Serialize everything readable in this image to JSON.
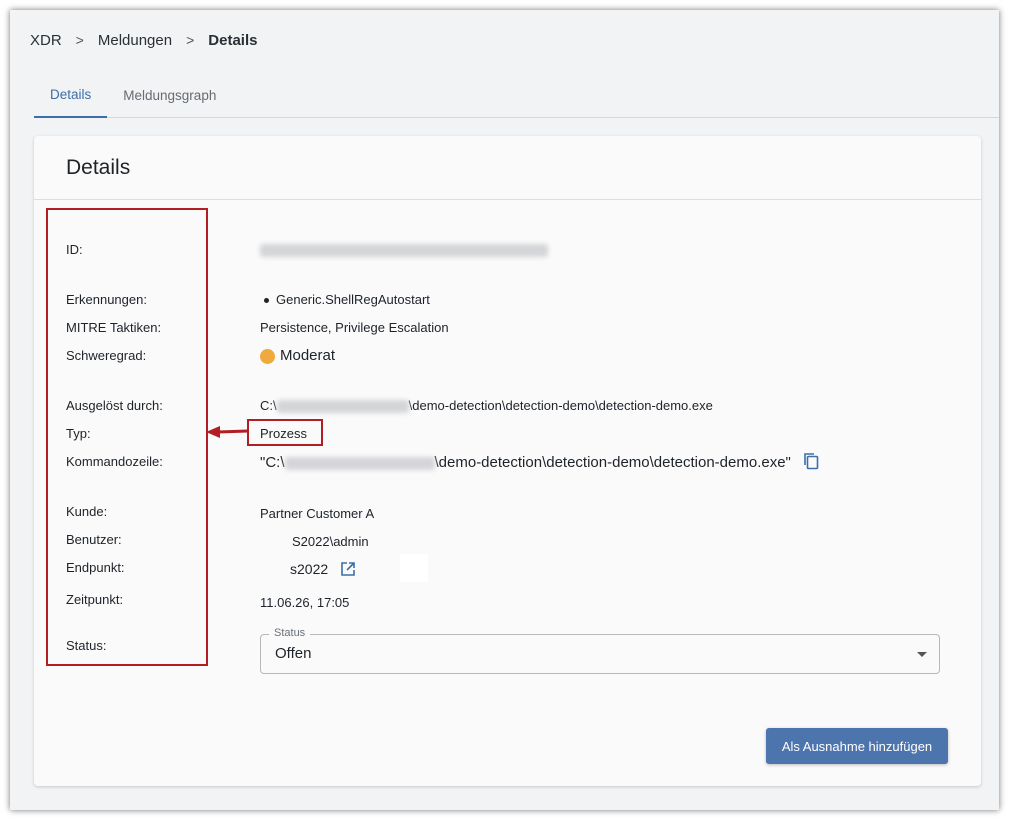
{
  "breadcrumb": {
    "items": [
      "XDR",
      "Meldungen"
    ],
    "current": "Details",
    "separator": ">"
  },
  "tabs": [
    {
      "label": "Details",
      "active": true
    },
    {
      "label": "Meldungsgraph",
      "active": false
    }
  ],
  "card": {
    "title": "Details",
    "fields": {
      "id_label": "ID:",
      "erkennungen_label": "Erkennungen:",
      "erkennungen_value": "Generic.ShellRegAutostart",
      "mitre_label": "MITRE Taktiken:",
      "mitre_value": "Persistence, Privilege Escalation",
      "schweregrad_label": "Schweregrad:",
      "schweregrad_value": "Moderat",
      "ausgeloest_label": "Ausgelöst durch:",
      "ausgeloest_prefix": "C:\\",
      "ausgeloest_suffix": "\\demo-detection\\detection-demo\\detection-demo.exe",
      "typ_label": "Typ:",
      "typ_value": "Prozess",
      "kommando_label": "Kommandozeile:",
      "kommando_prefix": "\"C:\\",
      "kommando_suffix": "\\demo-detection\\detection-demo\\detection-demo.exe\"",
      "kunde_label": "Kunde:",
      "kunde_value": "Partner Customer A",
      "benutzer_label": "Benutzer:",
      "benutzer_value": "S2022\\admin",
      "endpunkt_label": "Endpunkt:",
      "endpunkt_value": "s2022",
      "zeitpunkt_label": "Zeitpunkt:",
      "zeitpunkt_value": "11.06.26, 17:05",
      "status_label": "Status:"
    },
    "status_select": {
      "legend": "Status",
      "value": "Offen"
    },
    "button_label": "Als Ausnahme hinzufügen"
  },
  "colors": {
    "accent": "#3c6fa8",
    "button": "#4c74ad",
    "severity_moderate": "#f0a93c",
    "annotation_red": "#b11e23"
  },
  "icons": {
    "copy": "copy-icon",
    "external": "external-link-icon",
    "dropdown": "chevron-down-icon",
    "annotation_arrow": "arrow-left-icon"
  }
}
